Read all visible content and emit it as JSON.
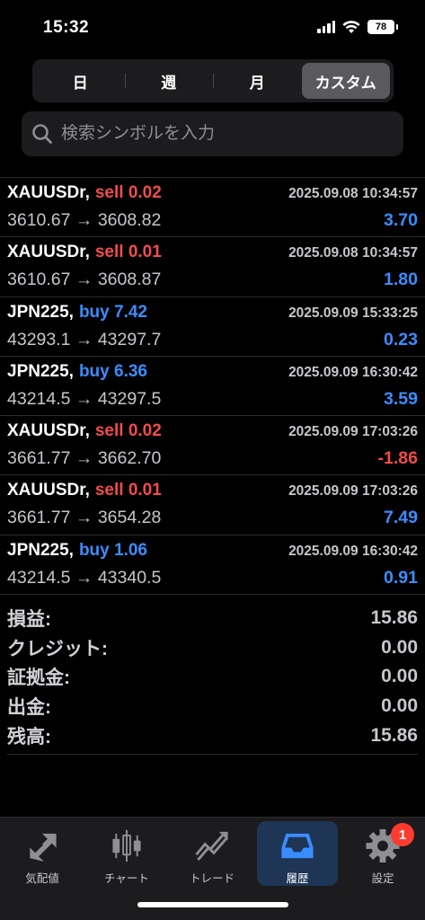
{
  "status": {
    "time": "15:32",
    "battery": "78"
  },
  "period_tabs": [
    {
      "label": "日",
      "active": false
    },
    {
      "label": "週",
      "active": false
    },
    {
      "label": "月",
      "active": false
    },
    {
      "label": "カスタム",
      "active": true
    }
  ],
  "search": {
    "placeholder": "検索シンボルを入力"
  },
  "deals": [
    {
      "symbol": "XAUUSDr,",
      "side": "sell",
      "volume": "sell 0.02",
      "time": "2025.09.08 10:34:57",
      "prices": "3610.67 → 3608.82",
      "profit": "3.70"
    },
    {
      "symbol": "XAUUSDr,",
      "side": "sell",
      "volume": "sell 0.01",
      "time": "2025.09.08 10:34:57",
      "prices": "3610.67 → 3608.87",
      "profit": "1.80"
    },
    {
      "symbol": "JPN225,",
      "side": "buy",
      "volume": "buy 7.42",
      "time": "2025.09.09 15:33:25",
      "prices": "43293.1 → 43297.7",
      "profit": "0.23"
    },
    {
      "symbol": "JPN225,",
      "side": "buy",
      "volume": "buy 6.36",
      "time": "2025.09.09 16:30:42",
      "prices": "43214.5 → 43297.5",
      "profit": "3.59"
    },
    {
      "symbol": "XAUUSDr,",
      "side": "sell",
      "volume": "sell 0.02",
      "time": "2025.09.09 17:03:26",
      "prices": "3661.77 → 3662.70",
      "profit": "-1.86"
    },
    {
      "symbol": "XAUUSDr,",
      "side": "sell",
      "volume": "sell 0.01",
      "time": "2025.09.09 17:03:26",
      "prices": "3661.77 → 3654.28",
      "profit": "7.49"
    },
    {
      "symbol": "JPN225,",
      "side": "buy",
      "volume": "buy 1.06",
      "time": "2025.09.09 16:30:42",
      "prices": "43214.5 → 43340.5",
      "profit": "0.91"
    }
  ],
  "summary": [
    {
      "label": "損益:",
      "value": "15.86"
    },
    {
      "label": "クレジット:",
      "value": "0.00"
    },
    {
      "label": "証拠金:",
      "value": "0.00"
    },
    {
      "label": "出金:",
      "value": "0.00"
    },
    {
      "label": "残高:",
      "value": "15.86"
    }
  ],
  "tabbar": [
    {
      "label": "気配値",
      "icon": "quotes-arrows-icon",
      "active": false
    },
    {
      "label": "チャート",
      "icon": "candlestick-icon",
      "active": false
    },
    {
      "label": "トレード",
      "icon": "trade-line-icon",
      "active": false
    },
    {
      "label": "履歴",
      "icon": "inbox-tray-icon",
      "active": true
    },
    {
      "label": "設定",
      "icon": "gear-icon",
      "active": false,
      "badge": "1"
    }
  ],
  "colors": {
    "sell": "#f24c4c",
    "buy": "#3a8dff",
    "active_tab_bg": "#1f3556",
    "badge": "#ff3b30"
  }
}
